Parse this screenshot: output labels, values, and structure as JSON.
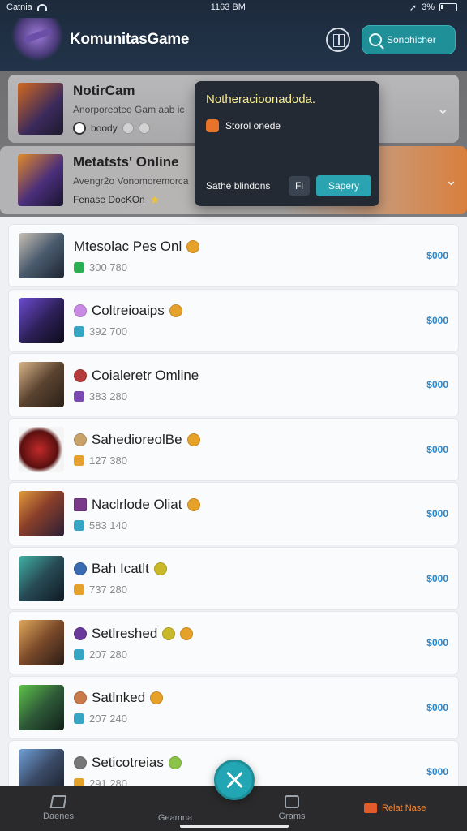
{
  "status": {
    "carrier": "Catnia",
    "time": "1163 BM",
    "battery": "3%"
  },
  "header": {
    "title": "KomunitasGame",
    "search_label": "Sonohicher"
  },
  "featured": [
    {
      "title": "NotirCam",
      "subtitle": "Anorporeateo Gam aab ic",
      "meta": "boody"
    },
    {
      "title": "Metatsts' Online",
      "subtitle": "Avengr2o Vonomoremorca",
      "meta": "Fenase DocKOn"
    }
  ],
  "popover": {
    "title": "Notheracioonadoda.",
    "item": "Storol onede",
    "footer_label": "Sathe blindons",
    "key": "Fl",
    "button": "Sapery"
  },
  "games": [
    {
      "name": "Mtesolac Pes Onl",
      "stats": "300 780",
      "price": "$000",
      "badge_color": "#e6a12a",
      "icon_color": "#2cae54"
    },
    {
      "name": "Coltreioaips",
      "stats": "392 700",
      "price": "$000",
      "badge_color": "#e6a12a",
      "icon_color": "#37a6c4"
    },
    {
      "name": "Coialeretr Omline",
      "stats": "383 280",
      "price": "$000",
      "badge_color": "#b53a3a",
      "icon_color": "#7a4ab0"
    },
    {
      "name": "SahedioreolBe",
      "stats": "127 380",
      "price": "$000",
      "badge_color": "#e6a12a",
      "icon_color": "#e6a12a"
    },
    {
      "name": "Naclrlode Oliat",
      "stats": "583 140",
      "price": "$000",
      "badge_color": "#e6a12a",
      "icon_color": "#37a6c4"
    },
    {
      "name": "Bah Icatlt",
      "stats": "737 280",
      "price": "$000",
      "badge_color": "#c9b82a",
      "icon_color": "#e6a12a"
    },
    {
      "name": "Setlreshed",
      "stats": "207 280",
      "price": "$000",
      "badge_color": "#e6a12a",
      "icon_color": "#37a6c4"
    },
    {
      "name": "Satlnked",
      "stats": "207 240",
      "price": "$000",
      "badge_color": "#e6a12a",
      "icon_color": "#37a6c4"
    },
    {
      "name": "Seticotreias",
      "stats": "291 280",
      "price": "$000",
      "badge_color": "#8bc34a",
      "icon_color": "#e6a12a"
    }
  ],
  "tabs": [
    {
      "label": "Daenes",
      "icon": "home-icon"
    },
    {
      "label": "Geamna",
      "icon": "fab-icon"
    },
    {
      "label": "Grams",
      "icon": "box-icon"
    },
    {
      "label": "Relat Nase",
      "icon": "tag-icon"
    }
  ]
}
